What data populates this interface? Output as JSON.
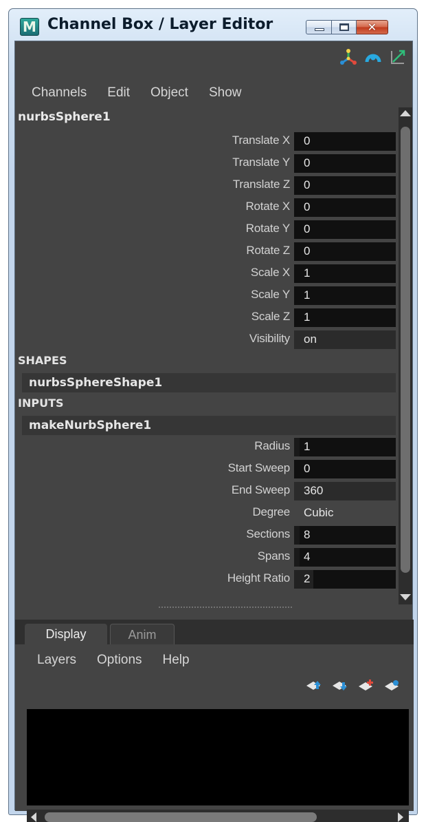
{
  "window": {
    "app_icon_letter": "M",
    "title": "Channel Box / Layer Editor"
  },
  "toolbar_icons": [
    "manipulator-icon",
    "speed-icon",
    "hyperbolic-icon"
  ],
  "channel_box": {
    "menus": [
      "Channels",
      "Edit",
      "Object",
      "Show"
    ],
    "object_name": "nurbsSphere1",
    "transform_attributes": [
      {
        "label": "Translate X",
        "value": "0"
      },
      {
        "label": "Translate Y",
        "value": "0"
      },
      {
        "label": "Translate Z",
        "value": "0"
      },
      {
        "label": "Rotate X",
        "value": "0"
      },
      {
        "label": "Rotate Y",
        "value": "0"
      },
      {
        "label": "Rotate Z",
        "value": "0"
      },
      {
        "label": "Scale X",
        "value": "1"
      },
      {
        "label": "Scale Y",
        "value": "1"
      },
      {
        "label": "Scale Z",
        "value": "1"
      },
      {
        "label": "Visibility",
        "value": "on"
      }
    ],
    "shapes_header": "SHAPES",
    "shape_node": "nurbsSphereShape1",
    "inputs_header": "INPUTS",
    "input_node": "makeNurbSphere1",
    "input_attributes": [
      {
        "label": "Radius",
        "value": "1"
      },
      {
        "label": "Start Sweep",
        "value": "0"
      },
      {
        "label": "End Sweep",
        "value": "360"
      },
      {
        "label": "Degree",
        "value": "Cubic"
      },
      {
        "label": "Sections",
        "value": "8"
      },
      {
        "label": "Spans",
        "value": "4"
      },
      {
        "label": "Height Ratio",
        "value": "2"
      }
    ]
  },
  "layer_editor": {
    "tabs": [
      "Display",
      "Anim"
    ],
    "menus": [
      "Layers",
      "Options",
      "Help"
    ],
    "icons": [
      "move-layer-up-icon",
      "move-layer-down-icon",
      "create-empty-layer-icon",
      "create-layer-from-selected-icon"
    ]
  },
  "colors": {
    "panel_bg": "#444444",
    "field_bg": "#101010",
    "accent_blue": "#2a8fd6",
    "accent_red": "#e04a3c",
    "accent_green": "#3bb35a"
  }
}
